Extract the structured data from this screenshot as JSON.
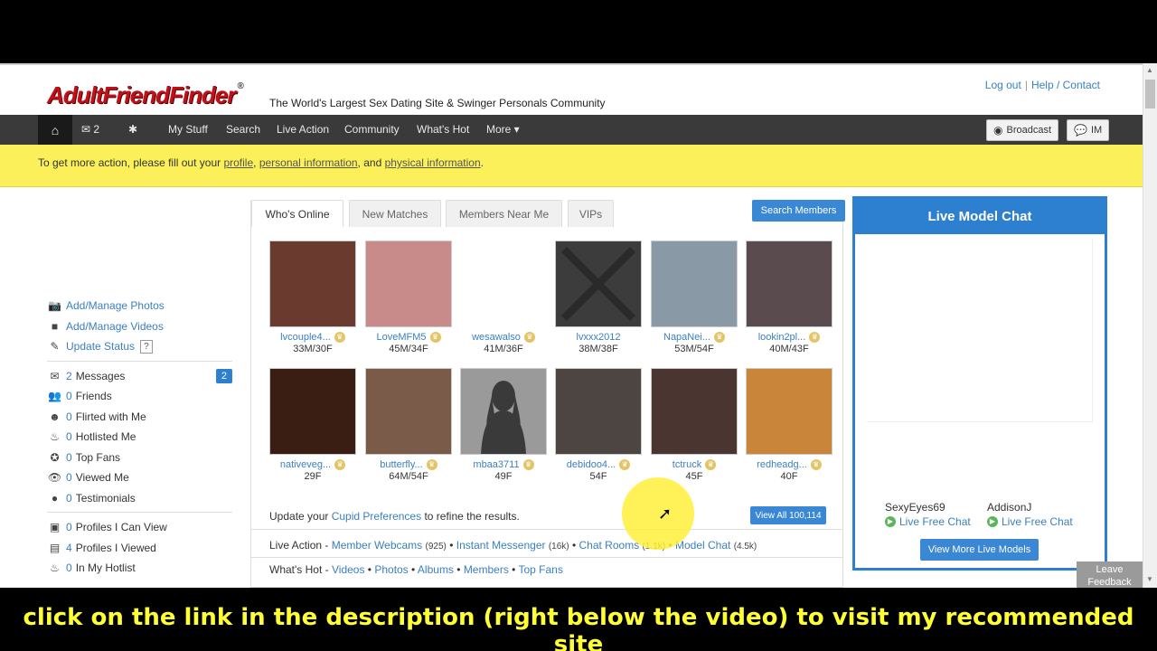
{
  "header": {
    "logo": "AdultFriendFinder",
    "logo_mark": "®",
    "tagline": "The World's Largest Sex Dating Site & Swinger Personals Community",
    "logout": "Log out",
    "help": "Help / Contact"
  },
  "nav": {
    "home_icon": "home-icon",
    "messages_count": "2",
    "items": [
      "My Stuff",
      "Search",
      "Live Action",
      "Community",
      "What's Hot",
      "More ▾"
    ],
    "broadcast": "Broadcast",
    "im": "IM"
  },
  "alert": {
    "prefix": "To get more action, please fill out your ",
    "link1": "profile",
    "sep1": ", ",
    "link2": "personal information",
    "sep2": ", and ",
    "link3": "physical information",
    "suffix": "."
  },
  "sidebar": {
    "actions": [
      {
        "icon": "camera-icon",
        "label": "Add/Manage Photos"
      },
      {
        "icon": "video-icon",
        "label": "Add/Manage Videos"
      },
      {
        "icon": "edit-icon",
        "label": "Update Status"
      }
    ],
    "help_mark": "?",
    "messages": {
      "count": "2",
      "label": "Messages",
      "badge": "2"
    },
    "stats": [
      {
        "icon": "friends-icon",
        "num": "0",
        "label": "Friends"
      },
      {
        "icon": "flirt-icon",
        "num": "0",
        "label": "Flirted with Me"
      },
      {
        "icon": "flame-icon",
        "num": "0",
        "label": "Hotlisted Me"
      },
      {
        "icon": "star-icon",
        "num": "0",
        "label": "Top Fans"
      },
      {
        "icon": "eye-icon",
        "num": "0",
        "label": "Viewed Me"
      },
      {
        "icon": "comment-icon",
        "num": "0",
        "label": "Testimonials"
      }
    ],
    "profiles": [
      {
        "icon": "profiles-icon",
        "num": "0",
        "label": "Profiles I Can View"
      },
      {
        "icon": "profiles-viewed-icon",
        "num": "4",
        "label": "Profiles I Viewed"
      },
      {
        "icon": "flame-icon",
        "num": "0",
        "label": "In My Hotlist"
      }
    ]
  },
  "tabs": [
    "Who's Online",
    "New Matches",
    "Members Near Me",
    "VIPs"
  ],
  "search_members": "Search Members",
  "members": [
    {
      "name": "lvcouple4...",
      "age": "33M/30F",
      "color": "#6a3a2e"
    },
    {
      "name": "LoveMFM5",
      "age": "45M/34F",
      "color": "#c98a8a"
    },
    {
      "name": "wesawalso",
      "age": "41M/36F",
      "color": "#ffffff"
    },
    {
      "name": "lvxxx2012",
      "age": "38M/38F",
      "color": "#3c3c3c"
    },
    {
      "name": "NapaNei...",
      "age": "53M/54F",
      "color": "#8a99a6"
    },
    {
      "name": "lookin2pl...",
      "age": "40M/43F",
      "color": "#5a4b4f"
    },
    {
      "name": "nativeveg...",
      "age": "29F",
      "color": "#3a1e14"
    },
    {
      "name": "butterfly...",
      "age": "64M/54F",
      "color": "#7a5a48"
    },
    {
      "name": "mbaa3711",
      "age": "49F",
      "color": "#8d8d8d"
    },
    {
      "name": "debidoo4...",
      "age": "54F",
      "color": "#4d4542"
    },
    {
      "name": "tctruck",
      "age": "45F",
      "color": "#4a3530"
    },
    {
      "name": "redheadg...",
      "age": "40F",
      "color": "#c9863a"
    }
  ],
  "cupid": {
    "prefix": "Update your ",
    "link": "Cupid Preferences",
    "suffix": " to refine the results."
  },
  "view_all": "View All 100,114",
  "live_action": {
    "label": "Live Action - ",
    "links": [
      {
        "text": "Member Webcams",
        "count": "(925)"
      },
      {
        "text": "Instant Messenger",
        "count": "(16k)"
      },
      {
        "text": "Chat Rooms",
        "count": "(1.1k)"
      },
      {
        "text": "Model Chat",
        "count": "(4.5k)"
      }
    ]
  },
  "whats_hot": {
    "label": "What's Hot - ",
    "links": [
      "Videos",
      "Photos",
      "Albums",
      "Members",
      "Top Fans"
    ]
  },
  "live_models": {
    "title": "Live Model Chat",
    "models": [
      {
        "name": "SexyEyes69",
        "chat": "Live Free Chat"
      },
      {
        "name": "AddisonJ",
        "chat": "Live Free Chat"
      }
    ],
    "more": "View More Live Models"
  },
  "feedback": {
    "line1": "Leave",
    "line2": "Feedback"
  },
  "caption": "click on the link in the description (right below the video) to visit my recommended site"
}
